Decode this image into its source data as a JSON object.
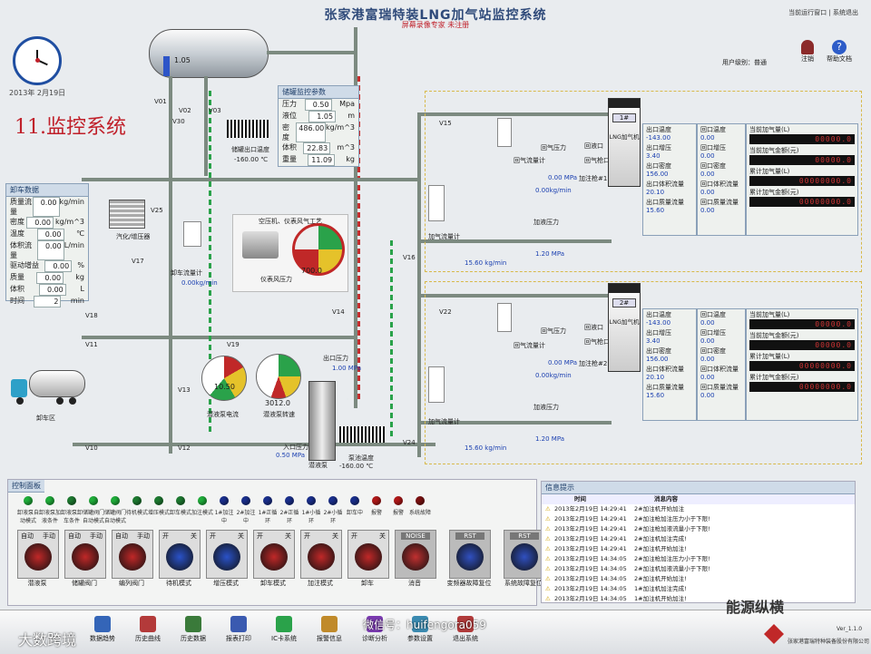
{
  "header": {
    "title": "张家港富瑞特装LNG加气站监控系统",
    "subtitle": "屏幕录像专家 未注册",
    "top_right": [
      "当前运行窗口",
      "系统退出"
    ],
    "user_label": "用户级别：普通",
    "logout_label": "注销",
    "help_label": "帮助文档"
  },
  "date": "2013年 2月19日",
  "overlay_title": "11.监控系统",
  "tank": {
    "level": "1.05"
  },
  "storage_panel": {
    "title": "储罐监控参数",
    "rows": [
      {
        "name": "压力",
        "value": "0.50",
        "unit": "Mpa"
      },
      {
        "name": "液位",
        "value": "1.05",
        "unit": "m"
      },
      {
        "name": "密度",
        "value": "486.00",
        "unit": "kg/m^3"
      },
      {
        "name": "体积",
        "value": "22.83",
        "unit": "m^3"
      },
      {
        "name": "重量",
        "value": "11.09",
        "unit": "kg"
      }
    ]
  },
  "unload_panel": {
    "title": "卸车数据",
    "rows": [
      {
        "name": "质量流量",
        "value": "0.00",
        "unit": "kg/min"
      },
      {
        "name": "密度",
        "value": "0.00",
        "unit": "kg/m^3"
      },
      {
        "name": "温度",
        "value": "0.00",
        "unit": "℃"
      },
      {
        "name": "体积流量",
        "value": "0.00",
        "unit": "L/min"
      },
      {
        "name": "驱动增益",
        "value": "0.00",
        "unit": "%"
      },
      {
        "name": "质量",
        "value": "0.00",
        "unit": "kg"
      },
      {
        "name": "体积",
        "value": "0.00",
        "unit": "L"
      },
      {
        "name": "时间",
        "value": "2",
        "unit": "min"
      }
    ]
  },
  "labels": {
    "tank_outlet_temp": "储罐出口温度",
    "tank_outlet_temp_val": "-160.00 ℃",
    "vaporizer": "汽化/增压器",
    "unload_flowmeter": "卸车流量计",
    "unload_flow_val": "0.00kg/min",
    "compressor_title": "空压机、仪表风气工艺",
    "instr_air": "仪表风压力",
    "instr_air_val": "700.0",
    "pump_current": "潜液泵电流",
    "pump_current_val": "10.50",
    "pump_speed": "潜液泵转速",
    "pump_speed_val": "3012.0",
    "outlet_pressure": "出口压力",
    "outlet_pressure_val": "1.00 MPa",
    "inlet_pressure": "入口压力",
    "inlet_pressure_val": "0.50 MPa",
    "pump_name": "潜液泵",
    "pump_temp": "泵池温度",
    "pump_temp_val": "-160.00 ℃",
    "unload_area": "卸车区",
    "return_flow": "回气流量计",
    "return_pressure": "回气压力",
    "fill_flow": "加气流量计",
    "fill_pressure": "加液压力",
    "return_port": "回液口",
    "return_gun": "回气枪口",
    "fill_gun1": "加注枪#1",
    "fill_gun2": "加注枪#2",
    "return_pressure_val": "0.00 MPa",
    "return_flow_val": "0.00kg/min",
    "fill_pressure_val": "1.20 MPa",
    "fill_flow_val": "15.60 kg/min"
  },
  "valves": [
    "V01",
    "V02",
    "V03",
    "V30",
    "V25",
    "V17",
    "V18",
    "V11",
    "V19",
    "V13",
    "V14",
    "V12",
    "V10",
    "V15",
    "V16",
    "V22",
    "V24",
    "V23",
    "V20"
  ],
  "dispensers": [
    {
      "id": "1#",
      "name": "LNG加气机",
      "out_temp": "-143.00",
      "out_pressure": "3.40",
      "out_density": "156.00",
      "out_vol_flow": "20.10",
      "out_mass_flow": "15.60",
      "ret_temp": "0.00",
      "ret_pressure": "0.00",
      "ret_density": "0.00",
      "ret_vol_flow": "0.00",
      "ret_mass_flow": "0.00",
      "cur_qty": "00000.0",
      "cur_amt": "00000.0",
      "total_qty": "00000000.0",
      "total_amt": "00000000.0"
    },
    {
      "id": "2#",
      "name": "LNG加气机",
      "out_temp": "-143.00",
      "out_pressure": "3.40",
      "out_density": "156.00",
      "out_vol_flow": "20.10",
      "out_mass_flow": "15.60",
      "ret_temp": "0.00",
      "ret_pressure": "0.00",
      "ret_density": "0.00",
      "ret_vol_flow": "0.00",
      "ret_mass_flow": "0.00",
      "cur_qty": "00000.0",
      "cur_amt": "00000.0",
      "total_qty": "00000000.0",
      "total_amt": "00000000.0"
    }
  ],
  "dispenser_labels": {
    "out_temp": "出口温度",
    "out_pressure": "出口增压",
    "out_density": "出口密度",
    "out_vol_flow": "出口体积流量",
    "out_mass_flow": "出口质量流量",
    "ret_temp": "回口温度",
    "ret_pressure": "回口增压",
    "ret_density": "回口密度",
    "ret_vol_flow": "回口体积流量",
    "ret_mass_flow": "回口质量流量",
    "cur_qty": "当前加气量(L)",
    "cur_amt": "当前加气金额(元)",
    "total_qty": "累计加气量(L)",
    "total_amt": "累计加气金额(元)"
  },
  "control_panel": {
    "title": "控制面板",
    "lamps": [
      {
        "label": "卸液泵自动模式",
        "color": "#1fae3a"
      },
      {
        "label": "卸液泵加液条件",
        "color": "#1fae3a"
      },
      {
        "label": "卸液泵卸车条件",
        "color": "#1d7a30"
      },
      {
        "label": "储罐阀门自动模式",
        "color": "#1fae3a"
      },
      {
        "label": "储罐阀门自动模式",
        "color": "#1fae3a"
      },
      {
        "label": "待机模式",
        "color": "#1d7a30"
      },
      {
        "label": "增压模式",
        "color": "#1d7a30"
      },
      {
        "label": "卸车模式",
        "color": "#1d7a30"
      },
      {
        "label": "加注模式",
        "color": "#1fae3a"
      },
      {
        "label": "1#加注中",
        "color": "#1a2f8c"
      },
      {
        "label": "2#加注中",
        "color": "#1a2f8c"
      },
      {
        "label": "1#正循环",
        "color": "#1a2f8c"
      },
      {
        "label": "2#正循环",
        "color": "#1a2f8c"
      },
      {
        "label": "1#小循环",
        "color": "#1a2f8c"
      },
      {
        "label": "2#小循环",
        "color": "#1a2f8c"
      },
      {
        "label": "卸车中",
        "color": "#1a2f8c"
      },
      {
        "label": "报警",
        "color": "#b01818"
      },
      {
        "label": "报警",
        "color": "#b01818"
      },
      {
        "label": "系统故障",
        "color": "#7a1010"
      }
    ],
    "switches": [
      {
        "label": "潜液泵",
        "left": "自动",
        "right": "手动",
        "knob": "#c02828"
      },
      {
        "label": "储罐阀门",
        "left": "自动",
        "right": "手动",
        "knob": "#c02828"
      },
      {
        "label": "编列阀门",
        "left": "自动",
        "right": "手动",
        "knob": "#c02828"
      },
      {
        "label": "待机模式",
        "left": "开",
        "right": "关",
        "knob": "#2a52c8"
      },
      {
        "label": "增压模式",
        "left": "开",
        "right": "关",
        "knob": "#2a52c8"
      },
      {
        "label": "卸车模式",
        "left": "开",
        "right": "关",
        "knob": "#c02828"
      },
      {
        "label": "加注模式",
        "left": "开",
        "right": "关",
        "knob": "#c02828"
      },
      {
        "label": "卸车",
        "left": "开",
        "right": "关",
        "knob": "#c02828"
      }
    ],
    "buttons": [
      {
        "label": "消音",
        "top": "NOISE"
      },
      {
        "label": "变频器故障复位",
        "top": "RST"
      },
      {
        "label": "系统故障复位",
        "top": "RST"
      }
    ]
  },
  "messages": {
    "title": "信息提示",
    "col_time": "时间",
    "col_msg": "消息内容",
    "rows": [
      {
        "time": "2013年2月19日 14:29:41",
        "msg": "2#加注机开始加注"
      },
      {
        "time": "2013年2月19日 14:29:41",
        "msg": "2#加注枪加注压力小于下限!"
      },
      {
        "time": "2013年2月19日 14:29:41",
        "msg": "2#加注枪加液流量小于下限!"
      },
      {
        "time": "2013年2月19日 14:29:41",
        "msg": "2#加注机加注完成!"
      },
      {
        "time": "2013年2月19日 14:29:41",
        "msg": "2#加注机开始加注!"
      },
      {
        "time": "2013年2月19日 14:34:05",
        "msg": "2#加注枪加注压力小于下限!"
      },
      {
        "time": "2013年2月19日 14:34:05",
        "msg": "2#加注机加液流量小于下限!"
      },
      {
        "time": "2013年2月19日 14:34:05",
        "msg": "2#加注机开始加注!"
      },
      {
        "time": "2013年2月19日 14:34:05",
        "msg": "1#加注机加注完成!"
      },
      {
        "time": "2013年2月19日 14:34:05",
        "msg": "1#加注机开始加注!"
      }
    ]
  },
  "toolbar": [
    {
      "label": "数据趋势",
      "color": "#3465b8"
    },
    {
      "label": "历史曲线",
      "color": "#b33a3a"
    },
    {
      "label": "历史数据",
      "color": "#3a7a3a"
    },
    {
      "label": "报表打印",
      "color": "#3a5ab0"
    },
    {
      "label": "IC卡系统",
      "color": "#2aa24a"
    },
    {
      "label": "报警信息",
      "color": "#c08a2a"
    },
    {
      "label": "诊断分析",
      "color": "#7a3ab0"
    },
    {
      "label": "参数设置",
      "color": "#3a8ab0"
    },
    {
      "label": "退出系统",
      "color": "#b03a3a"
    }
  ],
  "footer": {
    "watermark_left": "大数跨境",
    "watermark_center": "微信号：huifengora059",
    "watermark_right": "能源纵横",
    "company": "张家港富瑞特种装备股份有限公司",
    "version": "Ver_1.1.0"
  }
}
